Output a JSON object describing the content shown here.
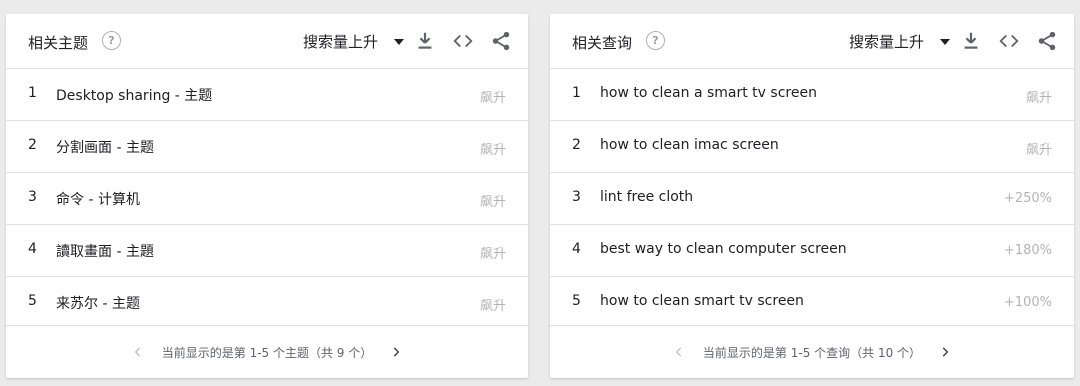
{
  "left_card": {
    "title": "相关主题",
    "help_glyph": "?",
    "sort_label": "搜索量上升",
    "rows": [
      {
        "num": "1",
        "label": "Desktop sharing - 主题",
        "value": "飙升"
      },
      {
        "num": "2",
        "label": "分割画面 - 主题",
        "value": "飙升"
      },
      {
        "num": "3",
        "label": "命令 - 计算机",
        "value": "飙升"
      },
      {
        "num": "4",
        "label": "讀取畫面 - 主題",
        "value": "飙升"
      },
      {
        "num": "5",
        "label": "来苏尔 - 主题",
        "value": "飙升"
      }
    ],
    "footer_text": "当前显示的是第 1-5 个主题（共 9 个）"
  },
  "right_card": {
    "title": "相关查询",
    "help_glyph": "?",
    "sort_label": "搜索量上升",
    "rows": [
      {
        "num": "1",
        "label": "how to clean a smart tv screen",
        "value": "飙升"
      },
      {
        "num": "2",
        "label": "how to clean imac screen",
        "value": "飙升"
      },
      {
        "num": "3",
        "label": "lint free cloth",
        "value": "+250%"
      },
      {
        "num": "4",
        "label": "best way to clean computer screen",
        "value": "+180%"
      },
      {
        "num": "5",
        "label": "how to clean smart tv screen",
        "value": "+100%"
      }
    ],
    "footer_text": "当前显示的是第 1-5 个查询（共 10 个）"
  },
  "icons": {
    "help": "help-circle-icon",
    "sort_caret": "caret-down-icon",
    "download": "download-icon",
    "embed": "code-embed-icon",
    "share": "share-icon",
    "prev": "chevron-left-icon",
    "next": "chevron-right-icon"
  },
  "colors": {
    "background": "#ebebeb",
    "card": "#ffffff",
    "muted_value": "#b4b4b4",
    "divider": "#e0e0e0"
  }
}
